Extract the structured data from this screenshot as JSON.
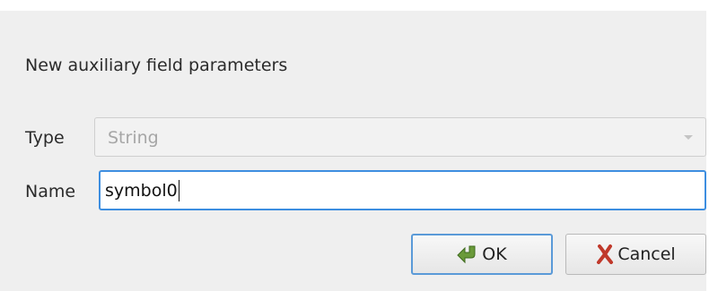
{
  "dialog": {
    "heading": "New auxiliary field parameters",
    "type_label": "Type",
    "type_value": "String",
    "name_label": "Name",
    "name_value": "symbol0",
    "ok_label": "OK",
    "cancel_label": "Cancel"
  },
  "icons": {
    "ok": "ok-arrow-icon",
    "cancel": "cancel-x-icon",
    "dropdown": "chevron-down-icon"
  },
  "colors": {
    "dialog_background": "#efefef",
    "focus_border": "#3d8ee0",
    "ok_icon": "#6a9a3a",
    "cancel_icon": "#c0392b"
  }
}
